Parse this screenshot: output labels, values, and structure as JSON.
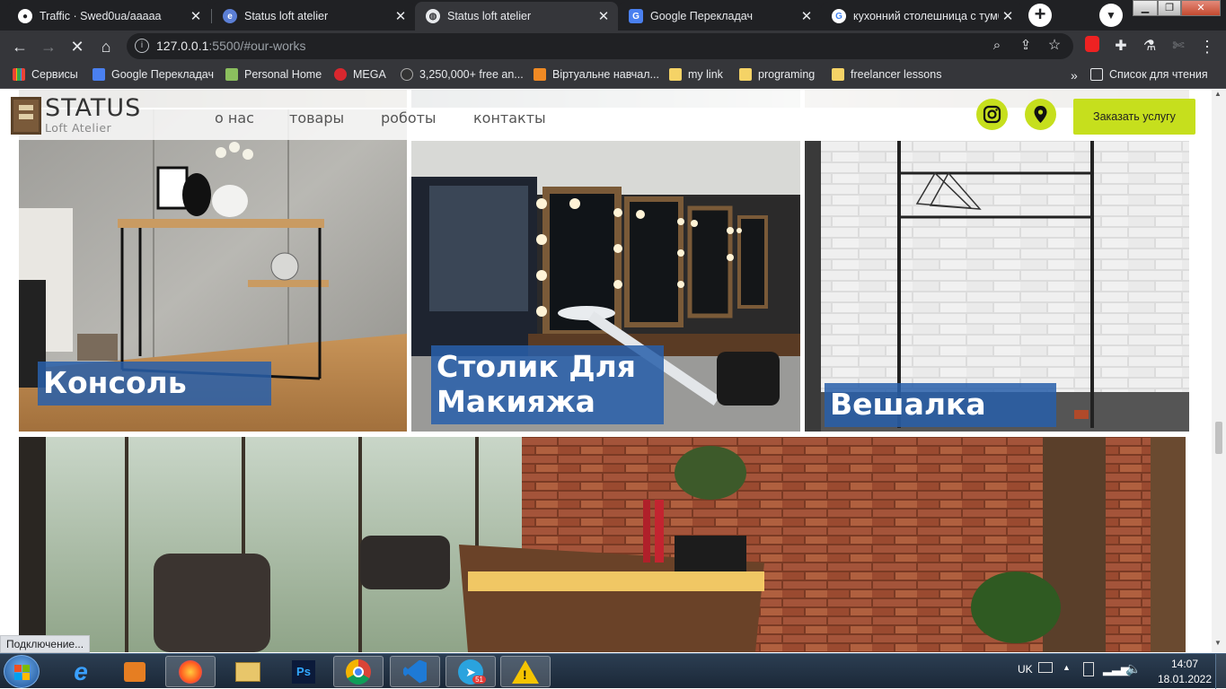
{
  "browser": {
    "tabs": [
      {
        "title": "Traffic · Swed0ua/aaaaa",
        "icon": "github-icon",
        "active": false
      },
      {
        "title": "Status loft atelier",
        "icon": "site-icon",
        "active": false
      },
      {
        "title": "Status loft atelier",
        "icon": "globe-icon",
        "active": true
      },
      {
        "title": "Google Перекладач",
        "icon": "google-translate-icon",
        "active": false
      },
      {
        "title": "кухонний столешница с тумб",
        "icon": "google-icon",
        "active": false
      }
    ],
    "url_host": "127.0.0.1",
    "url_rest": ":5500/#our-works",
    "bookmarks": [
      {
        "label": "Сервисы",
        "icon": "apps-icon"
      },
      {
        "label": "Google Перекладач",
        "icon": "google-translate-icon"
      },
      {
        "label": "Personal Home",
        "icon": "home-icon"
      },
      {
        "label": "MEGA",
        "icon": "mega-icon"
      },
      {
        "label": "3,250,000+ free an...",
        "icon": "bookmark-icon"
      },
      {
        "label": "Віртуальне навчал...",
        "icon": "bookmark-icon"
      },
      {
        "label": "my link",
        "icon": "folder-icon"
      },
      {
        "label": "programing",
        "icon": "folder-icon"
      },
      {
        "label": "freelancer lessons",
        "icon": "folder-icon"
      }
    ],
    "reading_list": "Список для чтения",
    "status": "Подключение..."
  },
  "site": {
    "logo_main": "STATUS",
    "logo_sub": "Loft Atelier",
    "nav": [
      "о нас",
      "товары",
      "роботы",
      "контакты"
    ],
    "order_button": "Заказать услугу",
    "works": [
      {
        "caption": "Консоль"
      },
      {
        "caption": "Столик Для Макияжа"
      },
      {
        "caption": "Вешалка"
      }
    ]
  },
  "taskbar": {
    "language": "UK",
    "time": "14:07",
    "date": "18.01.2022",
    "telegram_badge": "51"
  },
  "colors": {
    "accent": "#c6df1d",
    "caption_bg": "#285faa",
    "chrome_dark": "#202124",
    "chrome_mid": "#35363a"
  }
}
